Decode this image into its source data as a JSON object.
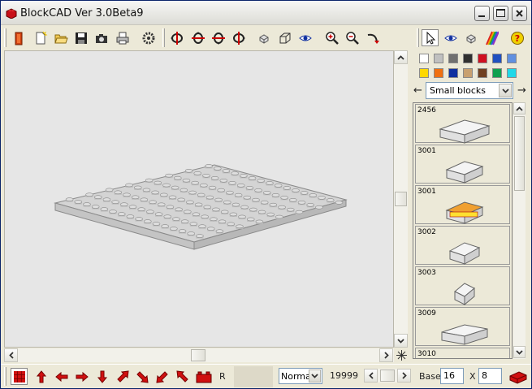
{
  "window": {
    "title": "BlockCAD Ver 3.0Beta9",
    "controls": [
      "minimize",
      "maximize",
      "close"
    ]
  },
  "toolbar": {
    "buttons": [
      "new-brick-icon",
      "new-file-icon",
      "open-folder-icon",
      "save-icon",
      "camera-icon",
      "print-icon",
      "settings-gear-icon",
      "rotate-left-icon",
      "rotate-up-icon",
      "rotate-down-icon",
      "rotate-right-icon",
      "small-brick-icon",
      "wireframe-icon",
      "view-eye-icon",
      "zoom-in-icon",
      "zoom-out-icon",
      "undo-arrow-icon"
    ],
    "right_buttons": [
      "select-arrow-icon",
      "view-eye-icon",
      "brick-view-icon",
      "rainbow-icon",
      "help-icon"
    ]
  },
  "palette": {
    "colors": [
      "#ffffff",
      "#c0c0c0",
      "#707070",
      "#303030",
      "#d01020",
      "#2050c0",
      "#6090e0",
      "#ffd800",
      "#f07010",
      "#1030a0",
      "#c8a070",
      "#704020",
      "#10a050",
      "#20d8e8"
    ]
  },
  "category": {
    "selected": "Small blocks"
  },
  "parts": [
    {
      "id": "2456"
    },
    {
      "id": "3001"
    },
    {
      "id": "3001"
    },
    {
      "id": "3002"
    },
    {
      "id": "3003"
    },
    {
      "id": "3009"
    },
    {
      "id": "3010"
    }
  ],
  "statusbar": {
    "r_label": "R",
    "mode_value": "Norma",
    "count": "19999",
    "base_label": "Base:",
    "base_x": "16",
    "x_label": "X",
    "base_y": "8"
  }
}
